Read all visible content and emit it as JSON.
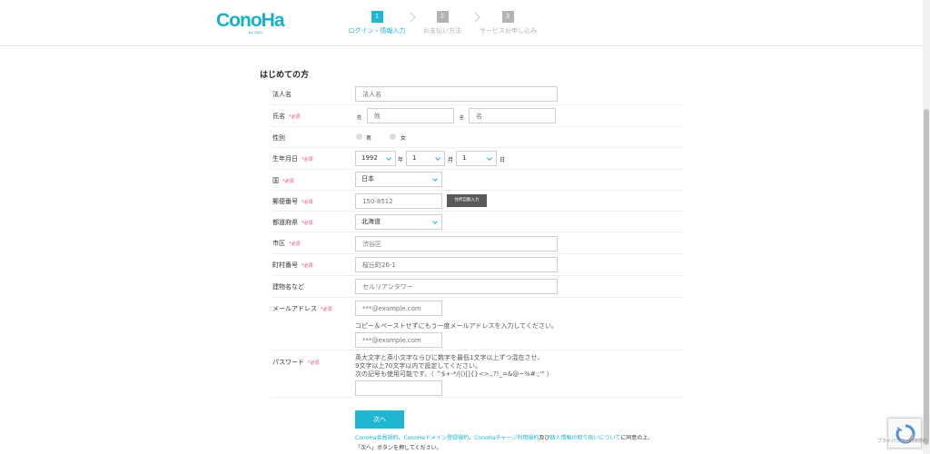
{
  "brand": {
    "logo": "ConoHa",
    "logo_sub": "by GMO"
  },
  "steps": [
    {
      "num": "1",
      "label": "ログイン・情報入力"
    },
    {
      "num": "2",
      "label": "お支払い方法"
    },
    {
      "num": "3",
      "label": "サービスお申し込み"
    }
  ],
  "section_title": "はじめての方",
  "required": "*必須",
  "form": {
    "corp_label": "法人名",
    "corp_placeholder": "法人名",
    "name_label": "氏名",
    "last_prefix": "姓",
    "last_placeholder": "姓",
    "first_prefix": "名",
    "first_placeholder": "名",
    "gender_label": "性別",
    "male": "男",
    "female": "女",
    "birth_label": "生年月日",
    "birth_year": "1992",
    "year_unit": "年",
    "birth_month": "1",
    "month_unit": "月",
    "birth_day": "1",
    "day_unit": "日",
    "country_label": "国",
    "country_value": "日本",
    "postal_label": "郵便番号",
    "postal_placeholder": "150-8512",
    "addr_auto_button": "住所自動入力",
    "pref_label": "都道府県",
    "pref_value": "北海道",
    "city_label": "市区",
    "city_placeholder": "渋谷区",
    "town_label": "町村番号",
    "town_placeholder": "桜丘町26-1",
    "building_label": "建物名など",
    "building_placeholder": "セルリアンタワー",
    "email_label": "メールアドレス",
    "email_placeholder": "***@example.com",
    "email_hint": "コピー＆ペーストせずにもう一度メールアドレスを入力してください。",
    "email_confirm_placeholder": "***@example.com",
    "password_label": "パスワード",
    "password_hint_1": "英大文字と英小文字ならびに数字を最低1文字以上ずつ混在させ、",
    "password_hint_2": "9文字以上70文字以内で設定してください。",
    "password_hint_3": "次の記号も使用可能です。（ ^$+-*/|()[]{}<>.,?!_=&@~%#:;'\" ）"
  },
  "next_button": "次へ",
  "terms": {
    "link1": "ConoHa会員規約",
    "sep1": "、",
    "link2": "ConoHaドメイン登録規約",
    "sep2": "、",
    "link3": "ConoHaチャージ利用規約",
    "and": "及び",
    "link4": "個人情報の取り扱いについて",
    "agree": "に同意の上、",
    "line2": "「次へ」ボタンを押してください。"
  },
  "recaptcha": {
    "label": "プライバシー - 利用規約"
  },
  "colors": {
    "accent": "#1fb6d2",
    "required": "#e0447a",
    "dark_button": "#5a5a5a"
  }
}
